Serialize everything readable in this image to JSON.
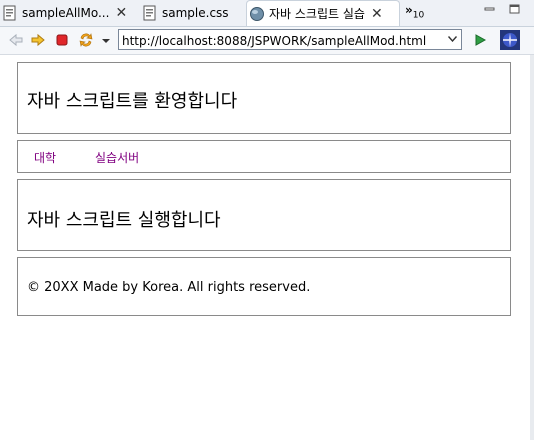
{
  "tabs": [
    {
      "label": "sampleAllMo...",
      "icon": "html-file-icon"
    },
    {
      "label": "sample.css",
      "icon": "css-file-icon"
    },
    {
      "label": "자바 스크립트 실습",
      "icon": "globe-icon",
      "active": true
    }
  ],
  "tab_overflow": {
    "symbol": "»",
    "count": "10"
  },
  "toolbar": {
    "url": "http://localhost:8088/JSPWORK/sampleAllMod.html"
  },
  "page": {
    "header_title": "자바 스크립트를 환영합니다",
    "nav": [
      "대학",
      "실습서버"
    ],
    "section_title": "자바 스크립트 실행합니다",
    "footer_text": "© 20XX Made by Korea. All rights reserved."
  },
  "colors": {
    "link": "#800080",
    "border": "#8a8a8a",
    "accent_tab": "#ffffff"
  }
}
